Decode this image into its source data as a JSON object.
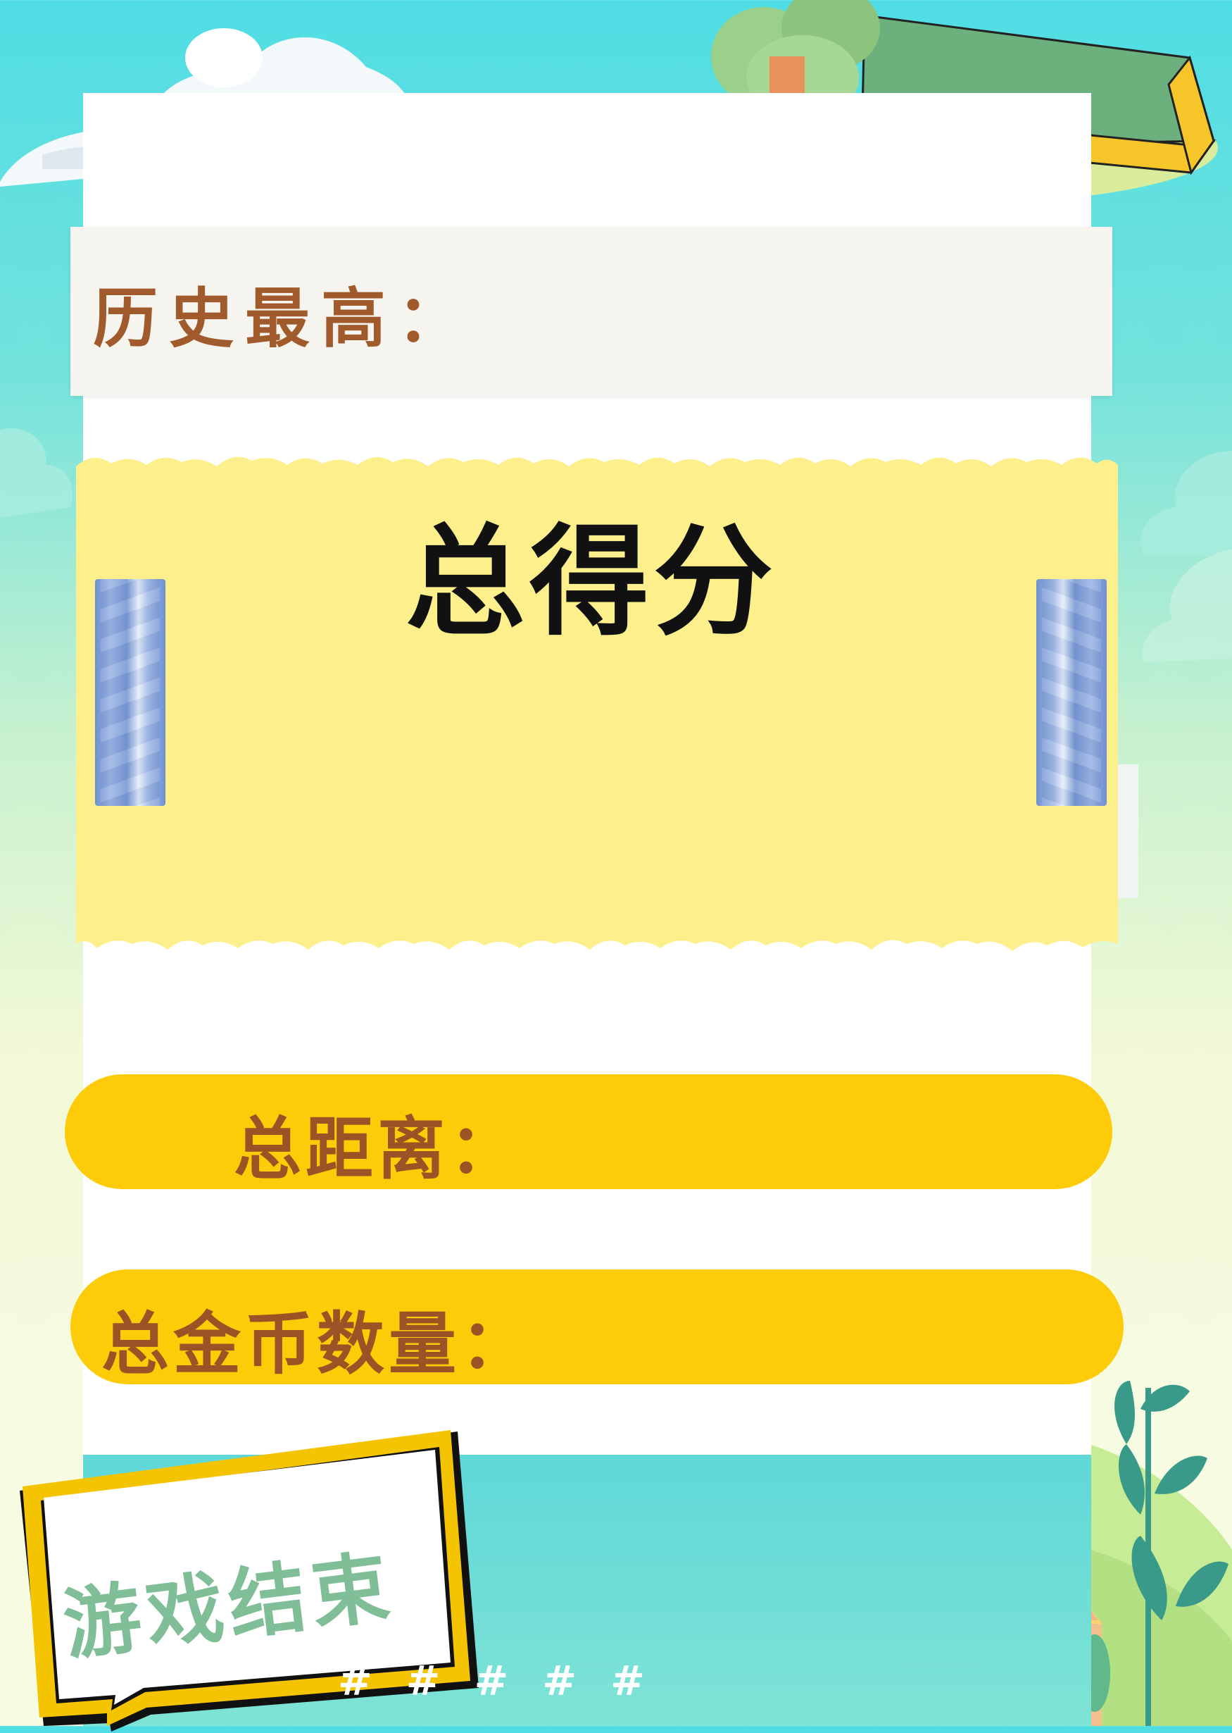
{
  "header": {
    "best_label": "历史最高：",
    "best_value": ""
  },
  "score": {
    "title": "总得分",
    "value": ""
  },
  "stats": [
    {
      "label": "总距离：",
      "value": ""
    },
    {
      "label": "总金币数量：",
      "value": ""
    }
  ],
  "footer": {
    "game_over": "游戏结束",
    "hashes": "# # # # #"
  },
  "decor": {
    "tree_icon": "tree-hug-icon",
    "sign_icon": "green-signboard-icon",
    "sun_icon": "sun-icon",
    "house_icon": "house-icon",
    "cloud_icon": "cloud-icon"
  },
  "colors": {
    "sky": "#4fdde4",
    "pill": "#fdcb08",
    "label_brown": "#a05a2c",
    "paper": "#fdf08c",
    "badge_border": "#f5c400",
    "badge_text": "#7fbe96"
  }
}
